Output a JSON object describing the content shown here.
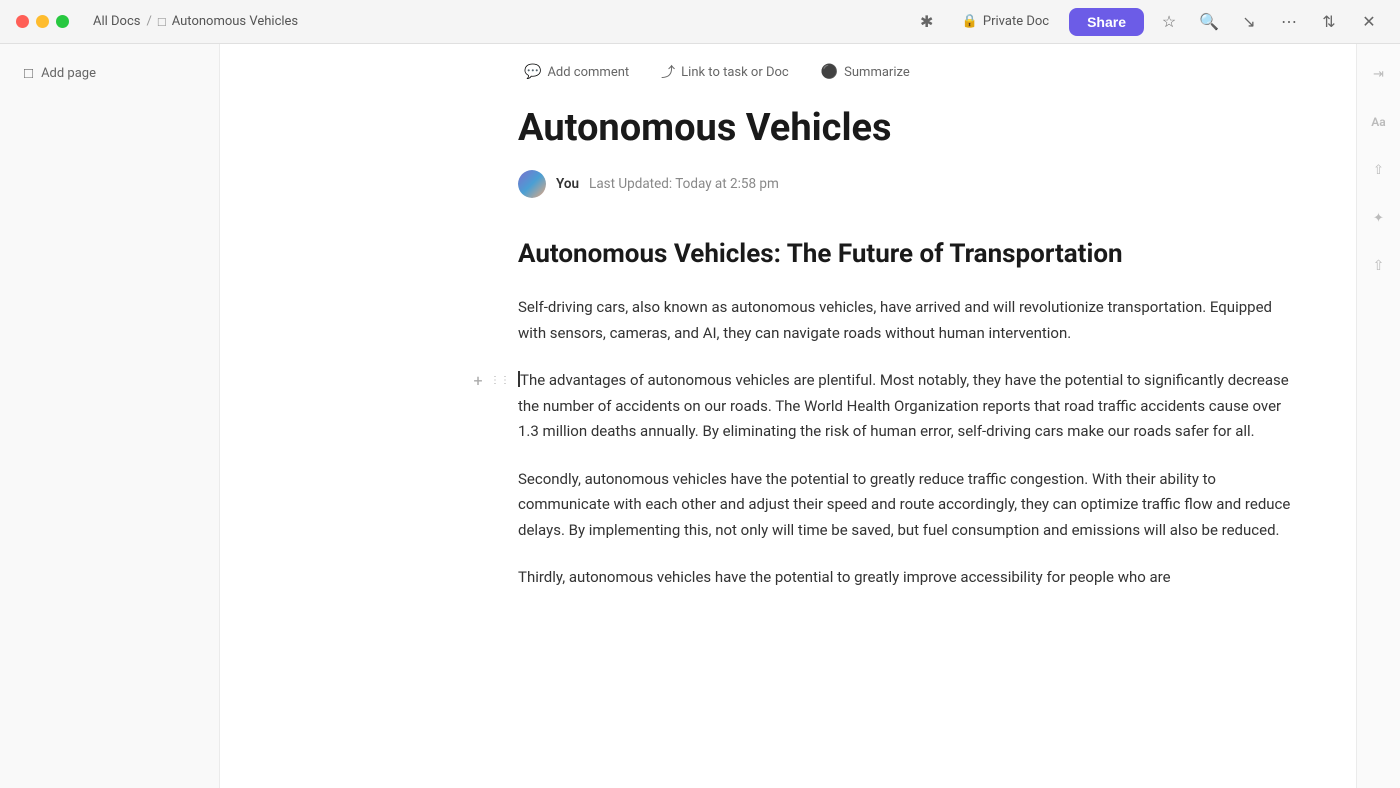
{
  "titlebar": {
    "breadcrumb_all": "All Docs",
    "breadcrumb_sep": "/",
    "doc_title": "Autonomous Vehicles",
    "private_doc_label": "Private Doc",
    "share_label": "Share"
  },
  "toolbar": {
    "add_comment": "Add comment",
    "link_to_task": "Link to task or Doc",
    "summarize": "Summarize"
  },
  "document": {
    "title": "Autonomous Vehicles",
    "author": "You",
    "last_updated": "Last Updated: Today at 2:58 pm",
    "heading1": "Autonomous Vehicles: The Future of Transportation",
    "paragraph1": "Self-driving cars, also known as autonomous vehicles, have arrived and will revolutionize transportation. Equipped with sensors, cameras, and AI, they can navigate roads without human intervention.",
    "paragraph2": "The advantages of autonomous vehicles are plentiful. Most notably, they have the potential to significantly decrease the number of accidents on our roads. The World Health Organization reports that road traffic accidents cause over 1.3 million deaths annually. By eliminating the risk of human error, self-driving cars make our roads safer for all.",
    "paragraph3": "Secondly, autonomous vehicles have the potential to greatly reduce traffic congestion. With their ability to communicate with each other and adjust their speed and route accordingly, they can optimize traffic flow and reduce delays. By implementing this, not only will time be saved, but fuel consumption and emissions will also be reduced.",
    "paragraph4": "Thirdly, autonomous vehicles have the potential to greatly improve accessibility for people who are"
  },
  "sidebar": {
    "add_page": "Add page"
  },
  "right_sidebar": {
    "collapse_icon": "←→",
    "font_icon": "Aa",
    "share_icon": "↗",
    "settings_icon": "✦",
    "upload_icon": "↑"
  }
}
